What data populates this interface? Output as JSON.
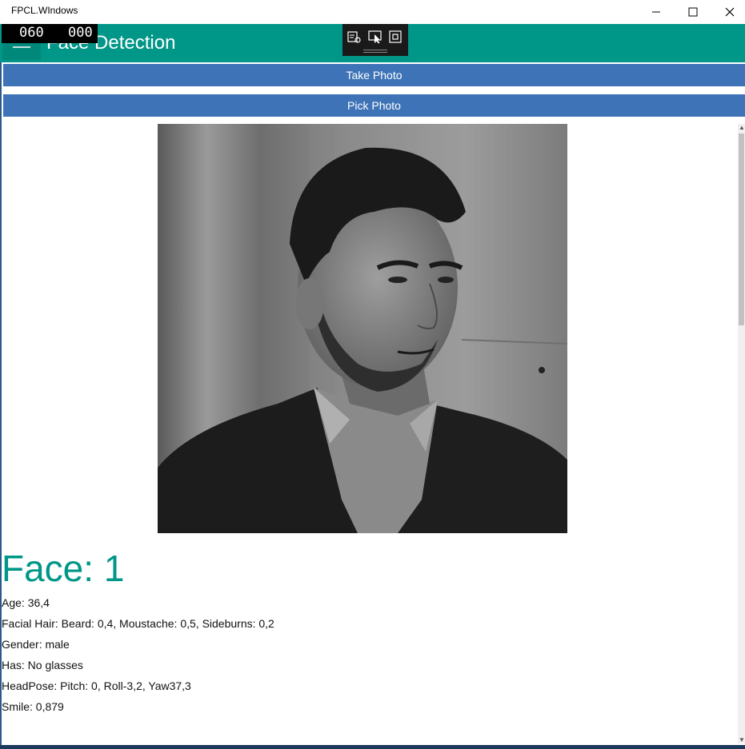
{
  "window": {
    "title": "FPCL.WIndows",
    "minimize_icon": "minimize-icon",
    "maximize_icon": "maximize-icon",
    "close_icon": "close-icon"
  },
  "appbar": {
    "title": "Face Detection",
    "menu_icon": "hamburger-icon",
    "accent": "#009688"
  },
  "fps_counter": {
    "left": "060",
    "right": "000"
  },
  "debug_toolbar": {
    "icons": [
      "live-tree-icon",
      "select-element-icon",
      "display-layout-adorners-icon"
    ]
  },
  "actions": {
    "take_photo": "Take Photo",
    "pick_photo": "Pick Photo",
    "button_color": "#3e74b7"
  },
  "result": {
    "face_title": "Face: 1",
    "lines": [
      "Age: 36,4",
      "Facial Hair: Beard: 0,4, Moustache: 0,5, Sideburns: 0,2",
      "Gender: male",
      "Has: No glasses",
      "HeadPose: Pitch: 0, Roll-3,2, Yaw37,3",
      "Smile: 0,879"
    ]
  }
}
